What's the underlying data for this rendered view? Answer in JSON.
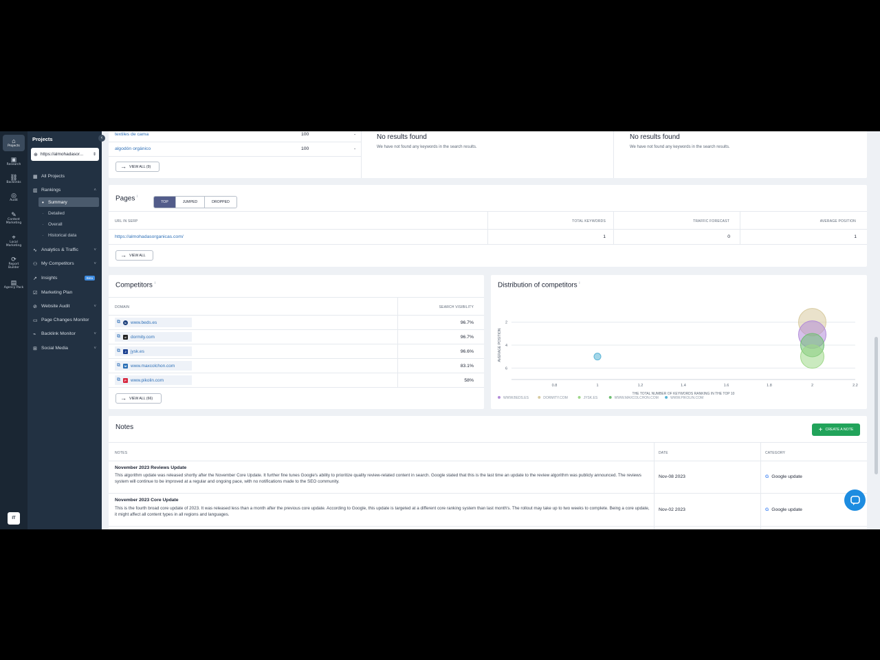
{
  "rail": [
    {
      "label": "Projects",
      "icon": "home-icon"
    },
    {
      "label": "Research",
      "icon": "research-icon"
    },
    {
      "label": "Backlinks",
      "icon": "link-icon"
    },
    {
      "label": "Audit",
      "icon": "audit-icon"
    },
    {
      "label": "Content Marketing",
      "icon": "content-icon"
    },
    {
      "label": "Local Marketing",
      "icon": "pin-icon"
    },
    {
      "label": "Report Builder",
      "icon": "report-icon"
    },
    {
      "label": "Agency Pack",
      "icon": "agency-icon"
    }
  ],
  "user_initials": "IT",
  "nav": {
    "title": "Projects",
    "project_url": "https://almohadasor...",
    "items": {
      "all_projects": "All Projects",
      "rankings": "Rankings",
      "summary": "Summary",
      "detailed": "Detailed",
      "overall": "Overall",
      "historical": "Historical data",
      "analytics": "Analytics & Traffic",
      "competitors": "My Competitors",
      "insights": "Insights",
      "insights_badge": "Beta",
      "marketing_plan": "Marketing Plan",
      "website_audit": "Website Audit",
      "page_changes": "Page Changes Monitor",
      "backlink_monitor": "Backlink Monitor",
      "social_media": "Social Media"
    }
  },
  "keywords_top": {
    "rows": [
      {
        "keyword": "textiles de cama",
        "value": "100",
        "change": "-"
      },
      {
        "keyword": "algodón orgánico",
        "value": "100",
        "change": "-"
      }
    ],
    "view_all": "VIEW ALL (9)"
  },
  "no_results": {
    "title": "No results found",
    "text": "We have not found any keywords in the search results."
  },
  "pages": {
    "title": "Pages",
    "tabs": [
      "TOP",
      "JUMPED",
      "DROPPED"
    ],
    "headers": [
      "URL IN SERP",
      "TOTAL KEYWORDS",
      "TRAFFIC FORECAST",
      "AVERAGE POSITION"
    ],
    "row": {
      "url": "https://almohadasorganicas.com/",
      "total": "1",
      "traffic": "0",
      "avg": "1"
    },
    "view_all": "VIEW ALL"
  },
  "competitors": {
    "title": "Competitors",
    "headers": [
      "DOMAIN",
      "SEARCH VISIBILITY"
    ],
    "rows": [
      {
        "domain": "www.beds.es",
        "visibility": "96.7%",
        "fav_color": "#1c3f7a",
        "fav": "b"
      },
      {
        "domain": "dormity.com",
        "visibility": "96.7%",
        "fav_color": "#222222",
        "fav": "d"
      },
      {
        "domain": "jysk.es",
        "visibility": "96.6%",
        "fav_color": "#1a3f8f",
        "fav": "J"
      },
      {
        "domain": "www.maxcolchon.com",
        "visibility": "83.1%",
        "fav_color": "#2a6fb5",
        "fav": "M"
      },
      {
        "domain": "www.pikolin.com",
        "visibility": "58%",
        "fav_color": "#d7263d",
        "fav": "P"
      }
    ],
    "view_all": "VIEW ALL (66)"
  },
  "distribution": {
    "title": "Distribution of competitors"
  },
  "chart_data": {
    "type": "scatter",
    "title": "Distribution of competitors",
    "xlabel": "THE TOTAL NUMBER OF KEYWORDS RANKING IN THE TOP 10",
    "ylabel": "AVERAGE POSITION",
    "xlim": [
      0.6,
      2.2
    ],
    "ylim": [
      1,
      7
    ],
    "x_ticks": [
      "0.8",
      "1",
      "1.2",
      "1.4",
      "1.6",
      "1.8",
      "2",
      "2.2"
    ],
    "y_ticks": [
      "2",
      "4",
      "6"
    ],
    "legend_position": "bottom",
    "series": [
      {
        "name": "WWW.BEDS.ES",
        "color": "#b38cd9",
        "points": [
          {
            "x": 2,
            "y": 2,
            "r": 20
          }
        ]
      },
      {
        "name": "DORMITY.COM",
        "color": "#d8cba0",
        "points": [
          {
            "x": 2,
            "y": 2,
            "r": 20
          }
        ]
      },
      {
        "name": "JYSK.ES",
        "color": "#9fd88a",
        "points": [
          {
            "x": 2,
            "y": 5,
            "r": 17
          }
        ]
      },
      {
        "name": "WWW.MAXCOLCHON.COM",
        "color": "#6fbf73",
        "points": [
          {
            "x": 2,
            "y": 4,
            "r": 17
          }
        ]
      },
      {
        "name": "WWW.PIKOLIN.COM",
        "color": "#5ab4d6",
        "points": [
          {
            "x": 1,
            "y": 5,
            "r": 5
          }
        ]
      }
    ]
  },
  "notes": {
    "title": "Notes",
    "create_label": "CREATE A NOTE",
    "headers": [
      "NOTES",
      "DATE",
      "CATEGORY"
    ],
    "rows": [
      {
        "title": "November 2023 Reviews Update",
        "body": "This algorithm update was released shortly after the November Core Update. It further fine tunes Google's ability to prioritize quality review-related content in search. Google stated that this is the last time an update to the review algorithm was publicly announced. The reviews system will continue to be improved at a regular and ongoing pace, with no notifications made to the SEO community.",
        "date": "Nov-08 2023",
        "category": "Google update"
      },
      {
        "title": "November 2023 Core Update",
        "body": "This is the fourth broad core update of 2023. It was released less than a month after the previous core update. According to Google, this update is targeted at a different core ranking system than last month's. The rollout may take up to two weeks to complete. Being a core update, it might affect all content types in all regions and languages.",
        "date": "Nov-02 2023",
        "category": "Google update"
      }
    ]
  }
}
